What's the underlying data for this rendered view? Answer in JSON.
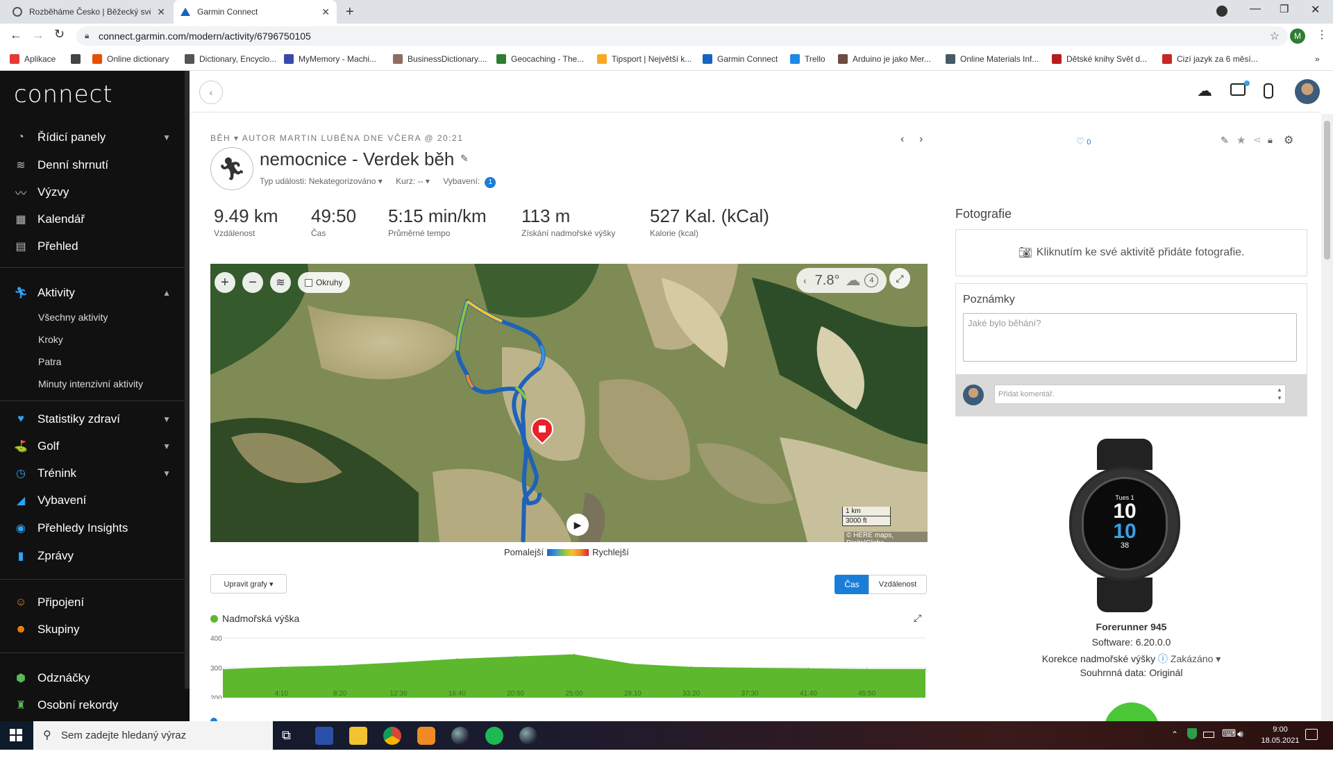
{
  "browser": {
    "tabs": [
      {
        "title": "Rozběháme Česko | Běžecký svě"
      },
      {
        "title": "Garmin Connect"
      }
    ],
    "url": "connect.garmin.com/modern/activity/6796750105",
    "profile_initial": "M",
    "bookmarks": [
      {
        "label": "Aplikace",
        "color": "#e53935"
      },
      {
        "label": "",
        "color": "#444"
      },
      {
        "label": "Online dictionary",
        "color": "#e65100"
      },
      {
        "label": "Dictionary, Encyclo...",
        "color": "#555"
      },
      {
        "label": "MyMemory - Machi...",
        "color": "#3949ab"
      },
      {
        "label": "BusinessDictionary....",
        "color": "#8d6e63"
      },
      {
        "label": "Geocaching - The...",
        "color": "#2e7d32"
      },
      {
        "label": "Tipsport | Největší k...",
        "color": "#f9a825"
      },
      {
        "label": "Garmin Connect",
        "color": "#1565c0"
      },
      {
        "label": "Trello",
        "color": "#1e88e5"
      },
      {
        "label": "Arduino je jako Mer...",
        "color": "#6d4c41"
      },
      {
        "label": "Online Materials Inf...",
        "color": "#455a64"
      },
      {
        "label": "Dětské knihy Svět d...",
        "color": "#b71c1c"
      },
      {
        "label": "Cizí jazyk za 6 měsí...",
        "color": "#c62828"
      }
    ]
  },
  "sidebar": {
    "logo": "connect",
    "items": [
      {
        "label": "Řídicí panely",
        "icon": "gauge-icon",
        "glyph": "◔",
        "chevron": true
      },
      {
        "label": "Denní shrnutí",
        "icon": "layers-icon",
        "glyph": "≋",
        "chevron": false
      },
      {
        "label": "Výzvy",
        "icon": "challenge-icon",
        "glyph": "〰",
        "chevron": false
      },
      {
        "label": "Kalendář",
        "icon": "calendar-icon",
        "glyph": "▦",
        "chevron": false
      },
      {
        "label": "Přehled",
        "icon": "report-icon",
        "glyph": "▤",
        "chevron": false
      }
    ],
    "activities": {
      "label": "Aktivity",
      "sub": [
        "Všechny aktivity",
        "Kroky",
        "Patra",
        "Minuty intenzivní aktivity"
      ]
    },
    "items2": [
      {
        "label": "Statistiky zdraví",
        "icon": "heart-icon",
        "glyph": "♥",
        "color": "#2ea3f2",
        "chevron": true
      },
      {
        "label": "Golf",
        "icon": "golf-icon",
        "glyph": "⛳",
        "color": "#2ea3f2",
        "chevron": true
      },
      {
        "label": "Trénink",
        "icon": "stopwatch-icon",
        "glyph": "◷",
        "color": "#2ea3f2",
        "chevron": true
      },
      {
        "label": "Vybavení",
        "icon": "shoe-icon",
        "glyph": "◢",
        "color": "#2ea3f2",
        "chevron": false
      },
      {
        "label": "Přehledy Insights",
        "icon": "bulb-icon",
        "glyph": "◉",
        "color": "#2ea3f2",
        "chevron": false
      },
      {
        "label": "Zprávy",
        "icon": "bar-chart-icon",
        "glyph": "▮",
        "color": "#2ea3f2",
        "chevron": false
      }
    ],
    "items3": [
      {
        "label": "Připojení",
        "icon": "connections-icon",
        "glyph": "☺",
        "color": "#ff8a00"
      },
      {
        "label": "Skupiny",
        "icon": "groups-icon",
        "glyph": "☻",
        "color": "#ff8a00"
      }
    ],
    "items4": [
      {
        "label": "Odznáčky",
        "icon": "badge-icon",
        "glyph": "⬢",
        "color": "#5cb85c"
      },
      {
        "label": "Osobní rekordy",
        "icon": "trophy-icon",
        "glyph": "♜",
        "color": "#5cb85c"
      }
    ]
  },
  "activity": {
    "meta_type": "BĚH",
    "meta_author": "AUTOR MARTIN LUBĚNA DNE VČERA @ 20:21",
    "title": "nemocnice - Verdek běh",
    "event_type": "Typ události: Nekategorizováno",
    "course": "Kurz: --",
    "gear": "Vybavení:",
    "gear_count": "1",
    "likes": "0",
    "stats": [
      {
        "value": "9.49 km",
        "label": "Vzdálenost"
      },
      {
        "value": "49:50",
        "label": "Čas"
      },
      {
        "value": "5:15 min/km",
        "label": "Průměrné tempo"
      },
      {
        "value": "113 m",
        "label": "Získání nadmořské výšky"
      },
      {
        "value": "527 Kal. (kCal)",
        "label": "Kalorie (kcal)"
      }
    ]
  },
  "map": {
    "laps_label": "Okruhy",
    "temperature": "7.8°",
    "wind": "4",
    "scale_km": "1 km",
    "scale_ft": "3000 ft",
    "copyright": "© HERE maps, DigitalGlobe",
    "legend_slow": "Pomalejší",
    "legend_fast": "Rychlejší"
  },
  "charts": {
    "edit_button": "Upravit grafy ▾",
    "toggle_time": "Čas",
    "toggle_distance": "Vzdálenost",
    "elevation_title": "Nadmořská výška"
  },
  "chart_data": {
    "type": "area",
    "title": "Nadmořská výška",
    "x": [
      "0:00",
      "4:10",
      "8:20",
      "12:30",
      "16:40",
      "20:50",
      "25:00",
      "29:10",
      "33:20",
      "37:30",
      "41:40",
      "45:50",
      "49:50"
    ],
    "xticks": [
      "4:10",
      "8:20",
      "12:30",
      "16:40",
      "20:50",
      "25:00",
      "29:10",
      "33:20",
      "37:30",
      "41:40",
      "45:50"
    ],
    "values": [
      295,
      303,
      308,
      318,
      330,
      338,
      345,
      313,
      303,
      300,
      298,
      296,
      296
    ],
    "yticks": [
      "400",
      "300",
      "200"
    ],
    "ylim": [
      200,
      400
    ],
    "color": "#5db82e"
  },
  "photos": {
    "title": "Fotografie",
    "add_text": "Kliknutím ke své aktivitě přidáte fotografie."
  },
  "notes": {
    "title": "Poznámky",
    "placeholder": "Jaké bylo běhání?",
    "comment_placeholder": "Přidat komentář."
  },
  "device": {
    "name": "Forerunner 945",
    "software": "Software: 6.20.0.0",
    "elev_corr_label": "Korekce nadmořské výšky",
    "elev_corr_value": "Zakázáno ▾",
    "summary": "Souhrnná data: Originál",
    "watch_day": "Tues 1",
    "watch_hour": "10",
    "watch_min": "10",
    "watch_hr": "38"
  },
  "taskbar": {
    "search_placeholder": "Sem zadejte hledaný výraz",
    "time": "9:00",
    "date": "18.05.2021"
  }
}
